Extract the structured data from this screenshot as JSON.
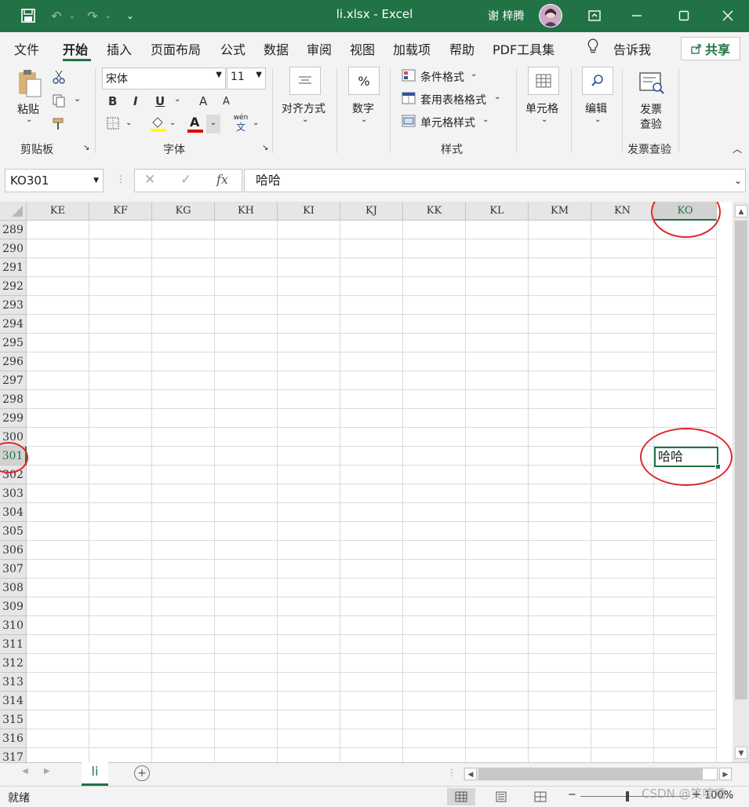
{
  "titlebar": {
    "title": "li.xlsx  -  Excel",
    "user_name": "谢 梓腾",
    "icons": [
      "save-icon",
      "undo-icon",
      "redo-icon",
      "customize-qat-icon",
      "ribbon-display-icon",
      "minimize-icon",
      "maximize-icon",
      "close-icon"
    ]
  },
  "menu": {
    "tabs": [
      "文件",
      "开始",
      "插入",
      "页面布局",
      "公式",
      "数据",
      "审阅",
      "视图",
      "加载项",
      "帮助",
      "PDF工具集"
    ],
    "active": "开始",
    "tell_me": "告诉我",
    "share": "共享"
  },
  "ribbon": {
    "clipboard": {
      "paste": "粘贴",
      "label": "剪贴板"
    },
    "font": {
      "name": "宋体",
      "size": "11",
      "bold": "B",
      "italic": "I",
      "underline": "U",
      "grow": "A",
      "shrink": "A",
      "font_color": "A",
      "phonetic_top": "wén",
      "phonetic_bottom": "文",
      "label": "字体"
    },
    "alignment": {
      "label": "对齐方式"
    },
    "number": {
      "symbol": "%",
      "label": "数字"
    },
    "styles": {
      "conditional": "条件格式",
      "table": "套用表格格式",
      "cell": "单元格样式",
      "label": "样式"
    },
    "cells": {
      "label": "单元格"
    },
    "editing": {
      "label": "编辑"
    },
    "invoice": {
      "line1": "发票",
      "line2": "查验",
      "label": "发票查验"
    }
  },
  "formula_bar": {
    "name_box": "KO301",
    "cancel": "✕",
    "enter": "✓",
    "fx": "fx",
    "content": "哈哈"
  },
  "grid": {
    "columns": [
      "KE",
      "KF",
      "KG",
      "KH",
      "KI",
      "KJ",
      "KK",
      "KL",
      "KM",
      "KN",
      "KO"
    ],
    "rows": [
      "289",
      "290",
      "291",
      "292",
      "293",
      "294",
      "295",
      "296",
      "297",
      "298",
      "299",
      "300",
      "301",
      "302",
      "303",
      "304",
      "305",
      "306",
      "307",
      "308",
      "309",
      "310",
      "311",
      "312",
      "313",
      "314",
      "315",
      "316",
      "317"
    ],
    "selected_column": "KO",
    "selected_row": "301",
    "selected_cell_value": "哈哈"
  },
  "sheets": {
    "tabs": [
      "li"
    ],
    "active": "li"
  },
  "status": {
    "text": "就绪",
    "zoom": "100%"
  },
  "watermark": "CSDN @笑嘻嘻",
  "colors": {
    "accent": "#217346",
    "annotation": "#e0262c"
  }
}
